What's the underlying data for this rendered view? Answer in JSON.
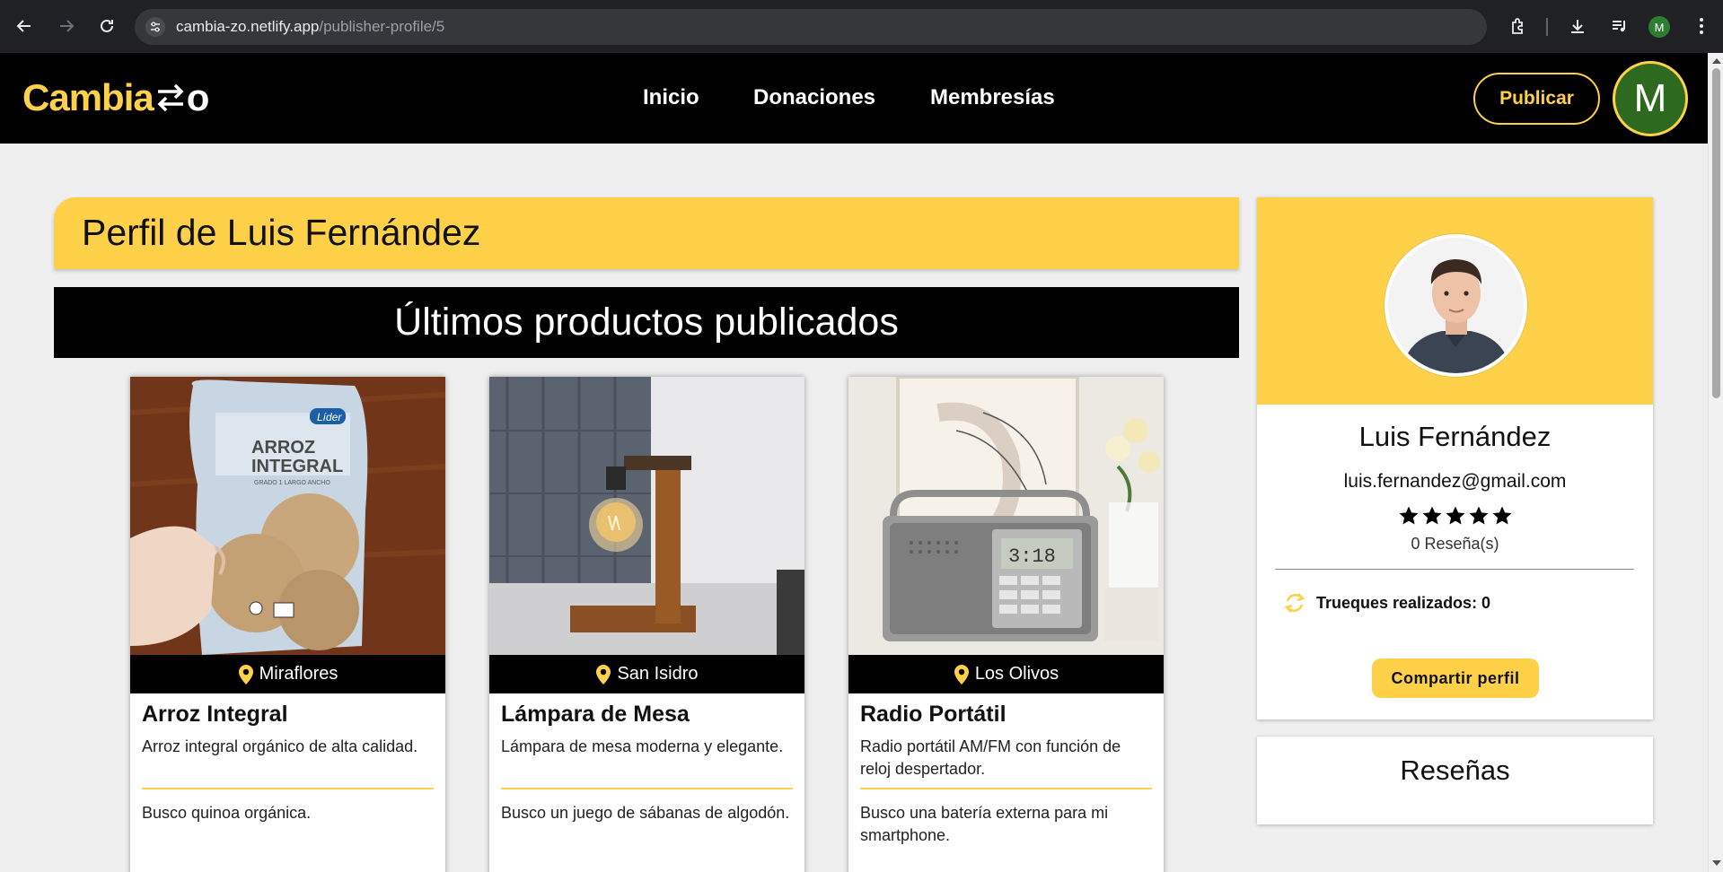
{
  "browser": {
    "url_domain": "cambia-zo.netlify.app",
    "url_path": "/publisher-profile/5",
    "profile_initial": "M",
    "icons": [
      "back-arrow-icon",
      "forward-arrow-icon",
      "reload-icon",
      "site-info-icon",
      "extensions-icon",
      "download-icon",
      "media-queue-icon",
      "kebab-menu-icon"
    ]
  },
  "site": {
    "logo_text": "Cambia",
    "logo_tail": "o",
    "nav": [
      "Inicio",
      "Donaciones",
      "Membresías"
    ],
    "publish_label": "Publicar",
    "avatar_initial": "M",
    "colors": {
      "accent": "#ffd149",
      "dark": "#000000",
      "avatar_bg": "#2d6a1f"
    }
  },
  "main": {
    "profile_title": "Perfil de Luis Fernández",
    "section_title": "Últimos productos publicados",
    "products": [
      {
        "location": "Miraflores",
        "title": "Arroz Integral",
        "description": "Arroz integral orgánico de alta calidad.",
        "seeking": "Busco quinoa orgánica.",
        "image_icon": "rice-bag-photo",
        "package_brand": "Líder",
        "package_title_1": "ARROZ",
        "package_title_2": "INTEGRAL",
        "package_sub": "GRADO 1 LARGO ANCHO"
      },
      {
        "location": "San Isidro",
        "title": "Lámpara de Mesa",
        "description": "Lámpara de mesa moderna y elegante.",
        "seeking": "Busco un juego de sábanas de algodón.",
        "image_icon": "lamp-photo"
      },
      {
        "location": "Los Olivos",
        "title": "Radio Portátil",
        "description": "Radio portátil AM/FM con función de reloj despertador.",
        "seeking": "Busco una batería externa para mi smartphone.",
        "image_icon": "radio-photo",
        "radio_display": "3:18"
      }
    ]
  },
  "sidebar": {
    "name": "Luis Fernández",
    "email": "luis.fernandez@gmail.com",
    "rating": 5,
    "reviews_count": "0 Reseña(s)",
    "trades": "Trueques realizados: 0",
    "share_label": "Compartir perfil",
    "reviews_heading": "Reseñas"
  }
}
